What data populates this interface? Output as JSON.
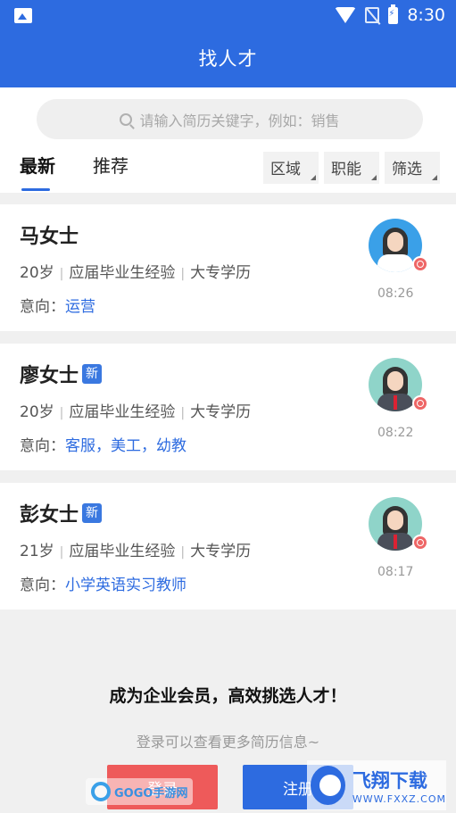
{
  "status_bar": {
    "time": "8:30"
  },
  "header": {
    "title": "找人才"
  },
  "search": {
    "placeholder": "请输入简历关键字，例如：销售"
  },
  "tabs": [
    {
      "label": "最新",
      "active": true
    },
    {
      "label": "推荐",
      "active": false
    }
  ],
  "filters": [
    "区域",
    "职能",
    "筛选"
  ],
  "candidates": [
    {
      "name": "马女士",
      "is_new": false,
      "age": "20岁",
      "experience": "应届毕业生经验",
      "education": "大专学历",
      "intent_label": "意向：",
      "intent": "运营",
      "time": "08:26",
      "avatar": "photo-avatar"
    },
    {
      "name": "廖女士",
      "is_new": true,
      "new_label": "新",
      "age": "20岁",
      "experience": "应届毕业生经验",
      "education": "大专学历",
      "intent_label": "意向：",
      "intent": "客服，美工，幼教",
      "time": "08:22",
      "avatar": "default-female-avatar"
    },
    {
      "name": "彭女士",
      "is_new": true,
      "new_label": "新",
      "age": "21岁",
      "experience": "应届毕业生经验",
      "education": "大专学历",
      "intent_label": "意向：",
      "intent": "小学英语实习教师",
      "time": "08:17",
      "avatar": "default-female-avatar"
    }
  ],
  "promo": {
    "title": "成为企业会员，高效挑选人才！",
    "subtitle": "登录可以查看更多简历信息~"
  },
  "buttons": {
    "login": "登录",
    "register": "注册"
  },
  "watermarks": {
    "left": "GOGO手游网",
    "right_title": "飞翔下载",
    "right_url": "WWW.FXXZ.COM"
  },
  "colors": {
    "primary": "#2d6be0",
    "login": "#ee5a5a",
    "badge": "#e66666"
  }
}
